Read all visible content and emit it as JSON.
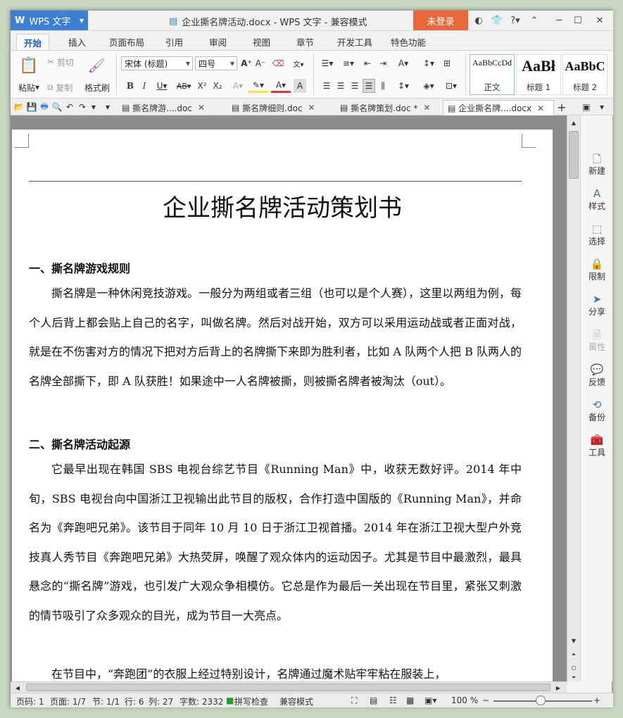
{
  "app": {
    "name": "WPS 文字",
    "title": "企业撕名牌活动.docx - WPS 文字 - 兼容模式",
    "login": "未登录"
  },
  "tabs": [
    "开始",
    "插入",
    "页面布局",
    "引用",
    "审阅",
    "视图",
    "章节",
    "开发工具",
    "特色功能"
  ],
  "ribbon": {
    "paste": "粘贴",
    "cut": "剪切",
    "copy": "复制",
    "format_painter": "格式刷",
    "font_name": "宋体 (标题)",
    "font_size": "四号",
    "styles": [
      {
        "preview": "AaBbCcDd",
        "name": "正文"
      },
      {
        "preview": "AaBł",
        "name": "标题 1"
      },
      {
        "preview": "AaBbC",
        "name": "标题 2"
      }
    ]
  },
  "doc_tabs": [
    {
      "label": "撕名牌游....doc",
      "active": false
    },
    {
      "label": "撕名牌细则.doc",
      "active": false
    },
    {
      "label": "撕名牌策划.doc *",
      "active": false
    },
    {
      "label": "企业撕名牌....docx",
      "active": true
    }
  ],
  "document": {
    "title": "企业撕名牌活动策划书",
    "section1_heading": "一、撕名牌游戏规则",
    "section1_body": "撕名牌是一种休闲竞技游戏。一般分为两组或者三组（也可以是个人赛），这里以两组为例，每个人后背上都会贴上自己的名字，叫做名牌。然后对战开始，双方可以采用运动战或者正面对战，就是在不伤害对方的情况下把对方后背上的名牌撕下来即为胜利者，比如 A 队两个人把 B 队两人的名牌全部撕下，即 A 队获胜！如果途中一人名牌被撕，则被撕名牌者被淘汰（out）。",
    "section2_heading": "二、撕名牌活动起源",
    "section2_body": "它最早出现在韩国 SBS 电视台综艺节目《Running Man》中，收获无数好评。2014 年中旬，SBS 电视台向中国浙江卫视输出此节目的版权，合作打造中国版的《Running Man》，并命名为《奔跑吧兄弟》。该节目于同年 10 月 10 日于浙江卫视首播。2014 年在浙江卫视大型户外竞技真人秀节目《奔跑吧兄弟》大热荧屏，唤醒了观众体内的运动因子。尤其是节目中最激烈，最具悬念的“撕名牌”游戏，也引发广大观众争相模仿。它总是作为最后一关出现在节目里，紧张又刺激的情节吸引了众多观众的目光，成为节目一大亮点。",
    "section2_next": "在节目中，“奔跑团”的衣服上经过特别设计，名牌通过魔术贴牢牢粘在服装上，"
  },
  "side_panel": [
    {
      "label": "新建",
      "icon": "new-doc-icon",
      "dim": false
    },
    {
      "label": "样式",
      "icon": "style-icon",
      "dim": false
    },
    {
      "label": "选择",
      "icon": "select-icon",
      "dim": false
    },
    {
      "label": "限制",
      "icon": "restrict-icon",
      "dim": false
    },
    {
      "label": "分享",
      "icon": "share-icon",
      "dim": false
    },
    {
      "label": "属性",
      "icon": "properties-icon",
      "dim": true
    },
    {
      "label": "反馈",
      "icon": "feedback-icon",
      "dim": false
    },
    {
      "label": "备份",
      "icon": "backup-icon",
      "dim": false
    },
    {
      "label": "工具",
      "icon": "tools-icon",
      "dim": false
    }
  ],
  "status": {
    "page_code": "页码: 1",
    "pages": "页面: 1/7",
    "section": "节: 1/1",
    "row": "行: 6",
    "col": "列: 27",
    "word_count": "字数: 2332",
    "spell_check": "拼写检查",
    "compat": "兼容模式",
    "zoom": "100 %"
  },
  "colors": {
    "accent": "#3d7fd4",
    "login": "#e8683a"
  }
}
